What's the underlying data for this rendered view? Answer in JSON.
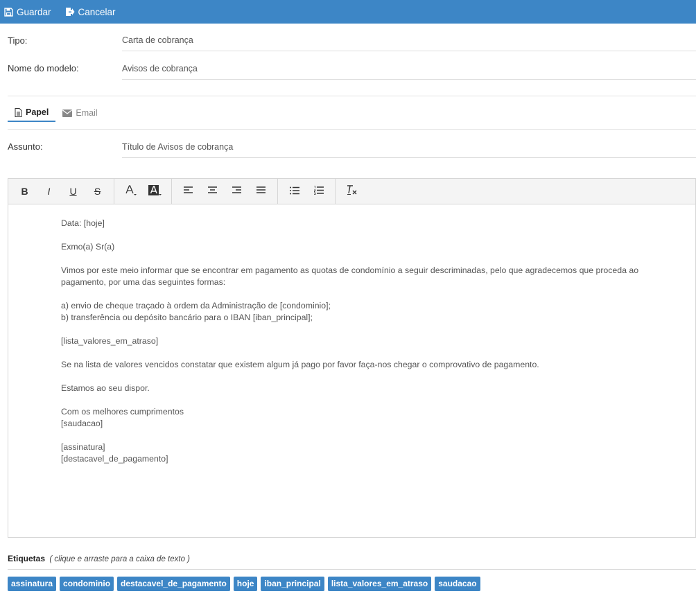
{
  "toolbar_top": {
    "save_label": "Guardar",
    "cancel_label": "Cancelar"
  },
  "form": {
    "tipo_label": "Tipo:",
    "tipo_value": "Carta de cobrança",
    "nome_label": "Nome do modelo:",
    "nome_value": "Avisos de cobrança",
    "assunto_label": "Assunto:",
    "assunto_value": "Título de Avisos de cobrança"
  },
  "tabs": [
    {
      "label": "Papel",
      "icon": "document-icon",
      "active": true
    },
    {
      "label": "Email",
      "icon": "envelope-icon",
      "active": false
    }
  ],
  "editor_toolbar": {
    "bold": "B",
    "italic": "I",
    "underline": "U",
    "strike": "S",
    "font_color": "A",
    "bg_color": "A",
    "clear_format": "T"
  },
  "content": {
    "date": "Data: [hoje]",
    "greeting": "Exmo(a) Sr(a)",
    "para1_line1": "Vimos por este meio informar que se encontrar em pagamento as quotas de condomínio a seguir descriminadas, pelo que agradecemos que proceda ao",
    "para1_line2": "pagamento, por uma das seguintes formas:",
    "opt_a": "a) envio de cheque traçado à ordem da Administração de [condominio];",
    "opt_b": "b) transferência ou depósito bancário para o IBAN [iban_principal];",
    "list": "[lista_valores_em_atraso]",
    "para2": "Se na lista de valores vencidos constatar que existem algum já pago por favor faça-nos chegar o comprovativo de pagamento.",
    "para3": "Estamos ao seu dispor.",
    "closing": "Com os melhores cumprimentos",
    "saudacao": "[saudacao]",
    "assinatura": "[assinatura]",
    "destacavel": "[destacavel_de_pagamento]"
  },
  "tags_section": {
    "title": "Etiquetas",
    "hint": "( clique e arraste para a caixa de texto )",
    "tags": [
      "assinatura",
      "condominio",
      "destacavel_de_pagamento",
      "hoje",
      "iban_principal",
      "lista_valores_em_atraso",
      "saudacao"
    ]
  },
  "colors": {
    "accent": "#3d86c6"
  }
}
